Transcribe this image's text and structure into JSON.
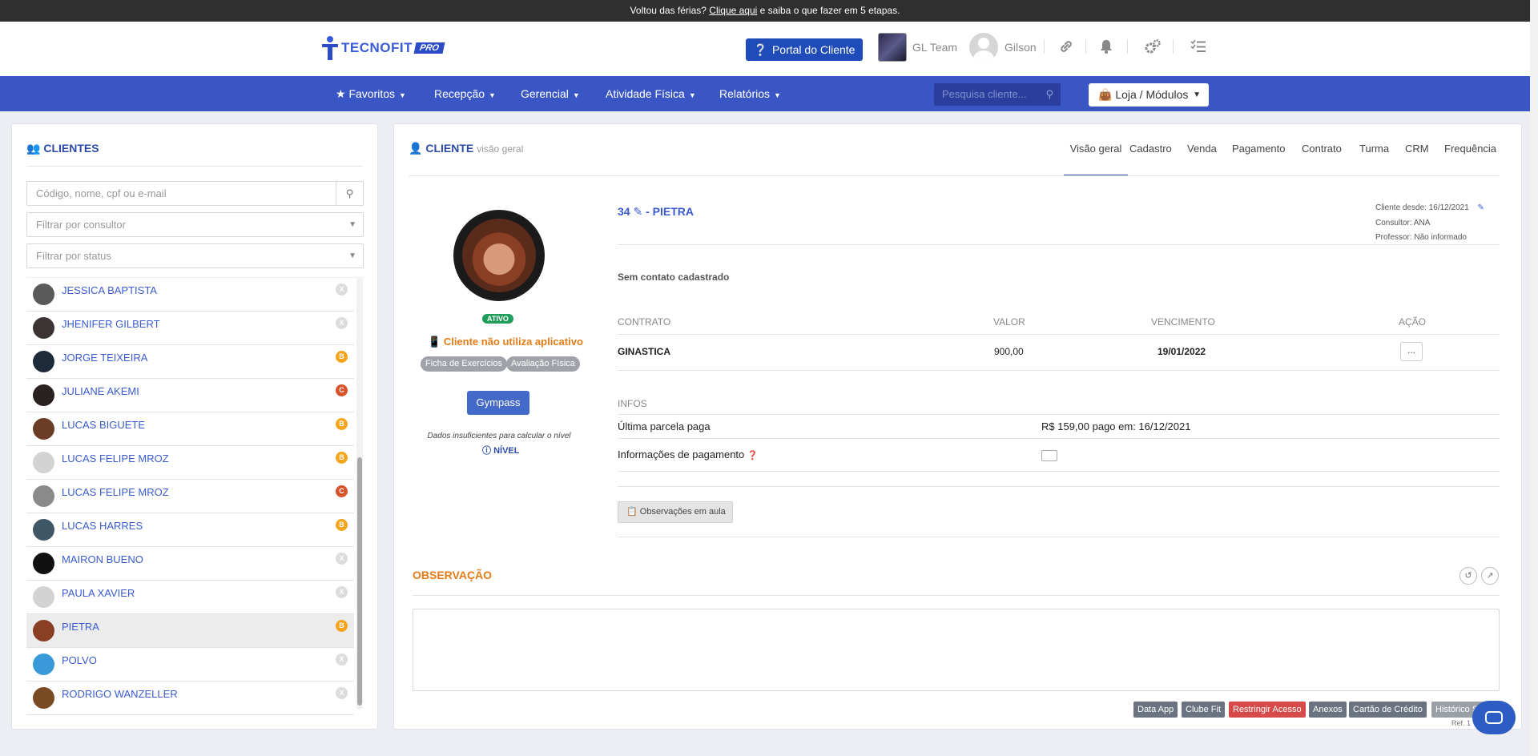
{
  "announce": {
    "prefix": "Voltou das férias? ",
    "link": "Clique aqui",
    "suffix": " e saiba o que fazer em 5 etapas."
  },
  "header": {
    "logo_word": "TECNOFIT",
    "logo_badge": "PRO",
    "portal_button": "Portal do Cliente",
    "team_name": "GL Team",
    "user_name": "Gilson"
  },
  "nav": {
    "items": [
      {
        "label": "Favoritos"
      },
      {
        "label": "Recepção"
      },
      {
        "label": "Gerencial"
      },
      {
        "label": "Atividade Física"
      },
      {
        "label": "Relatórios"
      }
    ],
    "search_placeholder": "Pesquisa cliente...",
    "store": "Loja / Módulos"
  },
  "clients_panel": {
    "title": "CLIENTES",
    "search_placeholder": "Código, nome, cpf ou e-mail",
    "filter_consultant": "Filtrar por consultor",
    "filter_status": "Filtrar por status",
    "clients": [
      {
        "name": "JESSICA BAPTISTA",
        "badge": "X"
      },
      {
        "name": "JHENIFER GILBERT",
        "badge": "X"
      },
      {
        "name": "JORGE TEIXEIRA",
        "badge": "B"
      },
      {
        "name": "JULIANE AKEMI",
        "badge": "C"
      },
      {
        "name": "LUCAS BIGUETE",
        "badge": "B"
      },
      {
        "name": "LUCAS FELIPE MROZ",
        "badge": "B"
      },
      {
        "name": "LUCAS FELIPE MROZ",
        "badge": "C"
      },
      {
        "name": "LUCAS HARRES",
        "badge": "B"
      },
      {
        "name": "MAIRON BUENO",
        "badge": "X"
      },
      {
        "name": "PAULA XAVIER",
        "badge": "X"
      },
      {
        "name": "PIETRA",
        "badge": "B",
        "selected": true
      },
      {
        "name": "POLVO",
        "badge": "X"
      },
      {
        "name": "RODRIGO WANZELLER",
        "badge": "X"
      }
    ]
  },
  "client": {
    "title": "CLIENTE",
    "subtitle": "visão geral",
    "tabs": [
      "Visão geral",
      "Cadastro",
      "Venda",
      "Pagamento",
      "Contrato",
      "Turma",
      "CRM",
      "Frequência"
    ],
    "status": "ATIVO",
    "app_notice": "Cliente não utiliza aplicativo",
    "tag_exercises": "Ficha de Exercícios",
    "tag_assessment": "Avaliação Física",
    "gympass": "Gympass",
    "level_text": "Dados insuficientes para calcular o nível",
    "level_label": "NÍVEL",
    "code": "34",
    "name": "- PIETRA",
    "client_since": "Cliente desde: 16/12/2021",
    "consultant": "Consultor: ANA",
    "teacher": "Professor: Não informado",
    "no_contact": "Sem contato cadastrado",
    "contracts_headers": {
      "contract": "CONTRATO",
      "value": "VALOR",
      "due": "VENCIMENTO",
      "action": "AÇÃO"
    },
    "contract": {
      "name": "GINASTICA",
      "value": "900,00",
      "due": "19/01/2022",
      "action": "..."
    },
    "infos_label": "INFOS",
    "last_payment_label": "Última parcela paga",
    "last_payment_value": "R$ 159,00 pago em: 16/12/2021",
    "payment_info_label": "Informações de pagamento",
    "class_notes": "Observações em aula",
    "observation_title": "OBSERVAÇÃO",
    "footer_buttons": [
      "Data App",
      "Clube Fit",
      "Restringir Acesso",
      "Anexos",
      "Cartão de Crédito",
      "Histórico S"
    ],
    "ref": "Ref. 1"
  }
}
